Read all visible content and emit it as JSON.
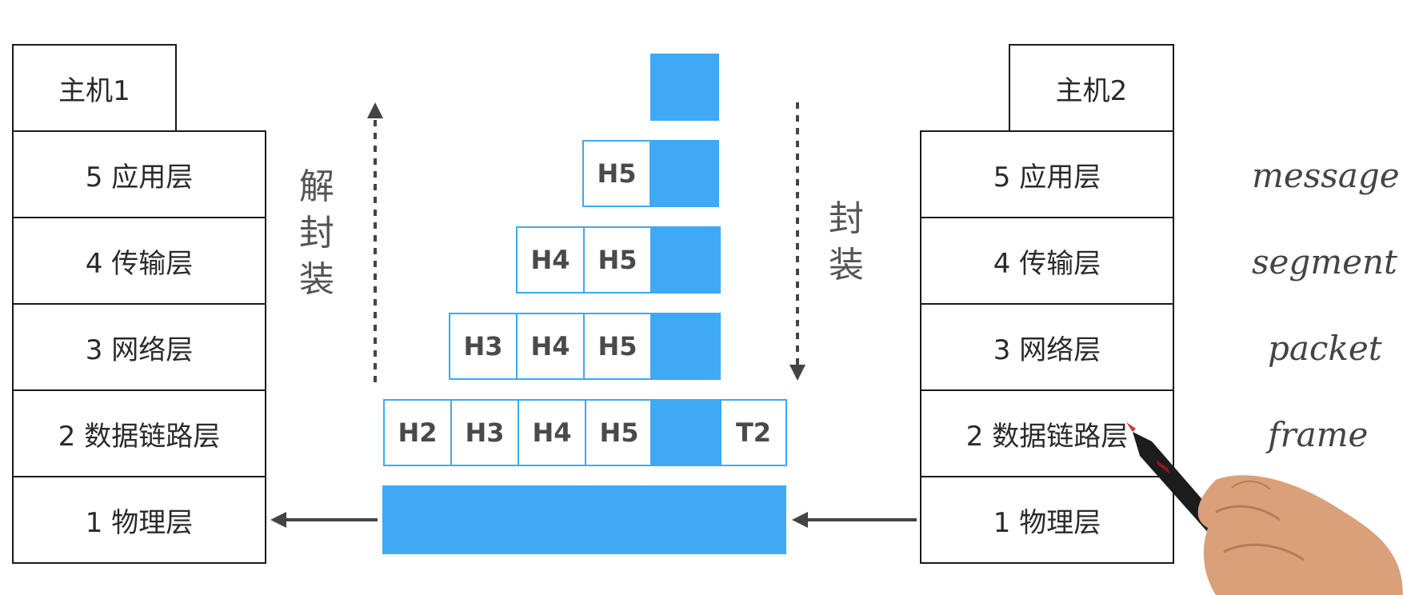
{
  "hosts": {
    "left": {
      "title": "主机1",
      "layers": [
        "5 应用层",
        "4 传输层",
        "3 网络层",
        "2 数据链路层",
        "1 物理层"
      ]
    },
    "right": {
      "title": "主机2",
      "layers": [
        "5 应用层",
        "4 传输层",
        "3 网络层",
        "2 数据链路层",
        "1 物理层"
      ]
    }
  },
  "labels": {
    "decapsulate": [
      "解",
      "封",
      "装"
    ],
    "encapsulate": [
      "封",
      "装"
    ]
  },
  "pdus": {
    "row_transport": [
      "H5"
    ],
    "row_network": [
      "H4",
      "H5"
    ],
    "row_datalink": [
      "H3",
      "H4",
      "H5"
    ],
    "row_physical_frame": [
      "H2",
      "H3",
      "H4",
      "H5"
    ],
    "trailer": "T2"
  },
  "pdu_names": [
    "message",
    "segment",
    "packet",
    "frame"
  ],
  "colors": {
    "data_fill": "#3fa9f5",
    "box_border": "#1a1a1a",
    "pdu_border": "#3fa9f5",
    "arrow": "#444444"
  }
}
